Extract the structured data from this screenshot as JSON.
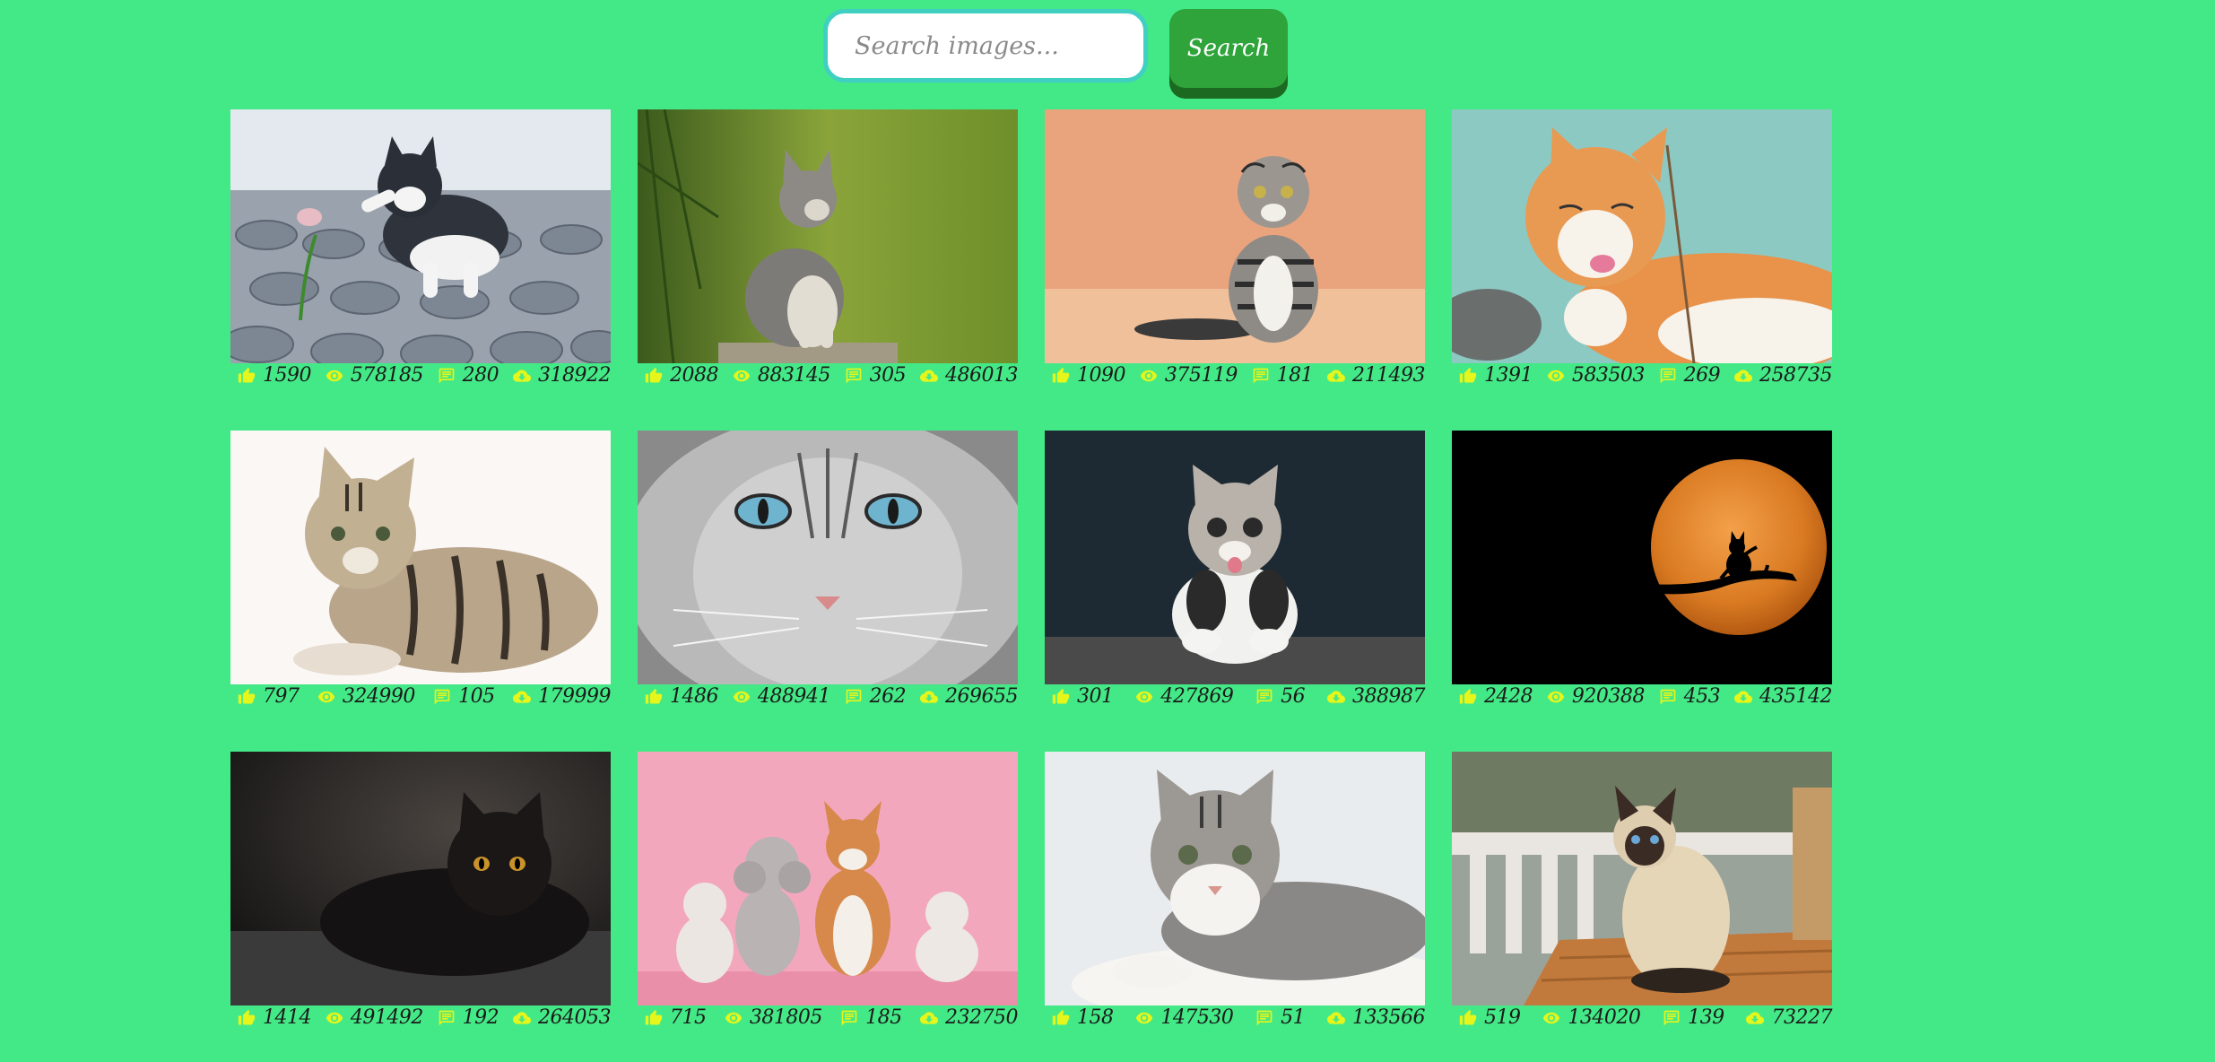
{
  "search": {
    "placeholder": "Search images...",
    "button_label": "Search"
  },
  "colors": {
    "background": "#44e987",
    "icon": "#e6f51a",
    "button": "#2fa43a",
    "input_border": "#3fd0c2"
  },
  "icons": {
    "likes": "thumbs-up-icon",
    "views": "eye-icon",
    "comments": "comment-icon",
    "downloads": "cloud-download-icon"
  },
  "images": [
    {
      "subject": "kitten-flower",
      "likes": "1590",
      "views": "578185",
      "comments": "280",
      "downloads": "318922"
    },
    {
      "subject": "kitten-grass",
      "likes": "2088",
      "views": "883145",
      "comments": "305",
      "downloads": "486013"
    },
    {
      "subject": "scottish-fold",
      "likes": "1090",
      "views": "375119",
      "comments": "181",
      "downloads": "211493"
    },
    {
      "subject": "orange-cat-licking",
      "likes": "1391",
      "views": "583503",
      "comments": "269",
      "downloads": "258735"
    },
    {
      "subject": "tabby-kitten-lying",
      "likes": "797",
      "views": "324990",
      "comments": "105",
      "downloads": "179999"
    },
    {
      "subject": "grey-cat-face",
      "likes": "1486",
      "views": "488941",
      "comments": "262",
      "downloads": "269655"
    },
    {
      "subject": "kitten-tongue",
      "likes": "301",
      "views": "427869",
      "comments": "56",
      "downloads": "388987"
    },
    {
      "subject": "cat-moon",
      "likes": "2428",
      "views": "920388",
      "comments": "453",
      "downloads": "435142"
    },
    {
      "subject": "black-cat",
      "likes": "1414",
      "views": "491492",
      "comments": "192",
      "downloads": "264053"
    },
    {
      "subject": "pets-pink",
      "likes": "715",
      "views": "381805",
      "comments": "185",
      "downloads": "232750"
    },
    {
      "subject": "tabby-white-cat",
      "likes": "158",
      "views": "147530",
      "comments": "51",
      "downloads": "133566"
    },
    {
      "subject": "siamese-cat",
      "likes": "519",
      "views": "134020",
      "comments": "139",
      "downloads": "73227"
    }
  ]
}
